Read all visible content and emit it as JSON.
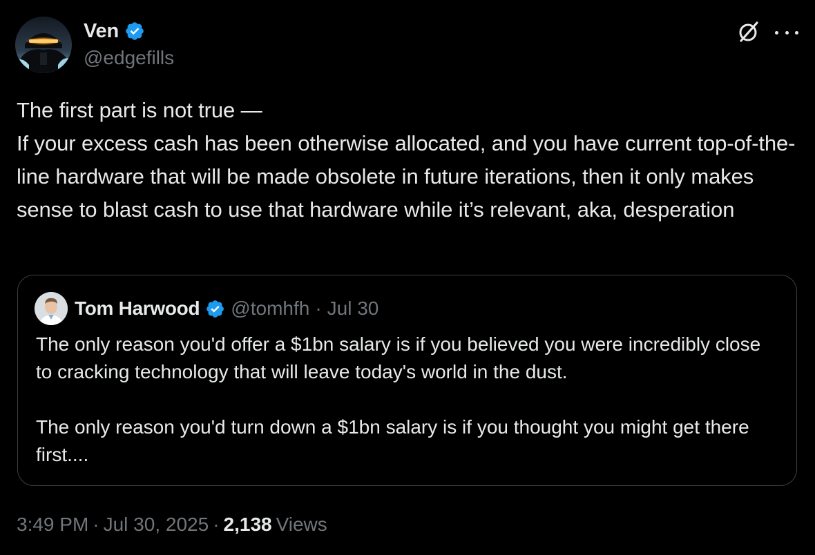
{
  "author": {
    "name": "Ven",
    "handle": "@edgefills",
    "verified": true,
    "avatar_icon": "avatar-helmet"
  },
  "header_actions": {
    "grok_icon": "grok-icon",
    "more_icon": "more-icon"
  },
  "tweet": {
    "text": "The first part is not true —\nIf your excess cash has been otherwise allocated, and you have current top-of-the-line hardware that will be made obsolete in future iterations, then it only makes sense to blast cash to use that hardware while it’s relevant, aka, desperation"
  },
  "quote": {
    "name": "Tom Harwood",
    "handle": "@tomhfh",
    "separator": "·",
    "date": "Jul 30",
    "verified": true,
    "text": "The only reason you'd offer a $1bn salary is if you believed you were incredibly close to cracking technology that will leave today's world in the dust.\n\nThe only reason you'd turn down a $1bn salary is if you thought you might get there first...."
  },
  "meta": {
    "time": "3:49 PM",
    "separator": "·",
    "date": "Jul 30, 2025",
    "separator2": "·",
    "views_count": "2,138",
    "views_label": "Views"
  },
  "colors": {
    "background": "#000000",
    "text": "#e7e9ea",
    "muted": "#71767b",
    "verified_blue": "#1d9bf0",
    "border": "#3a3f44"
  }
}
